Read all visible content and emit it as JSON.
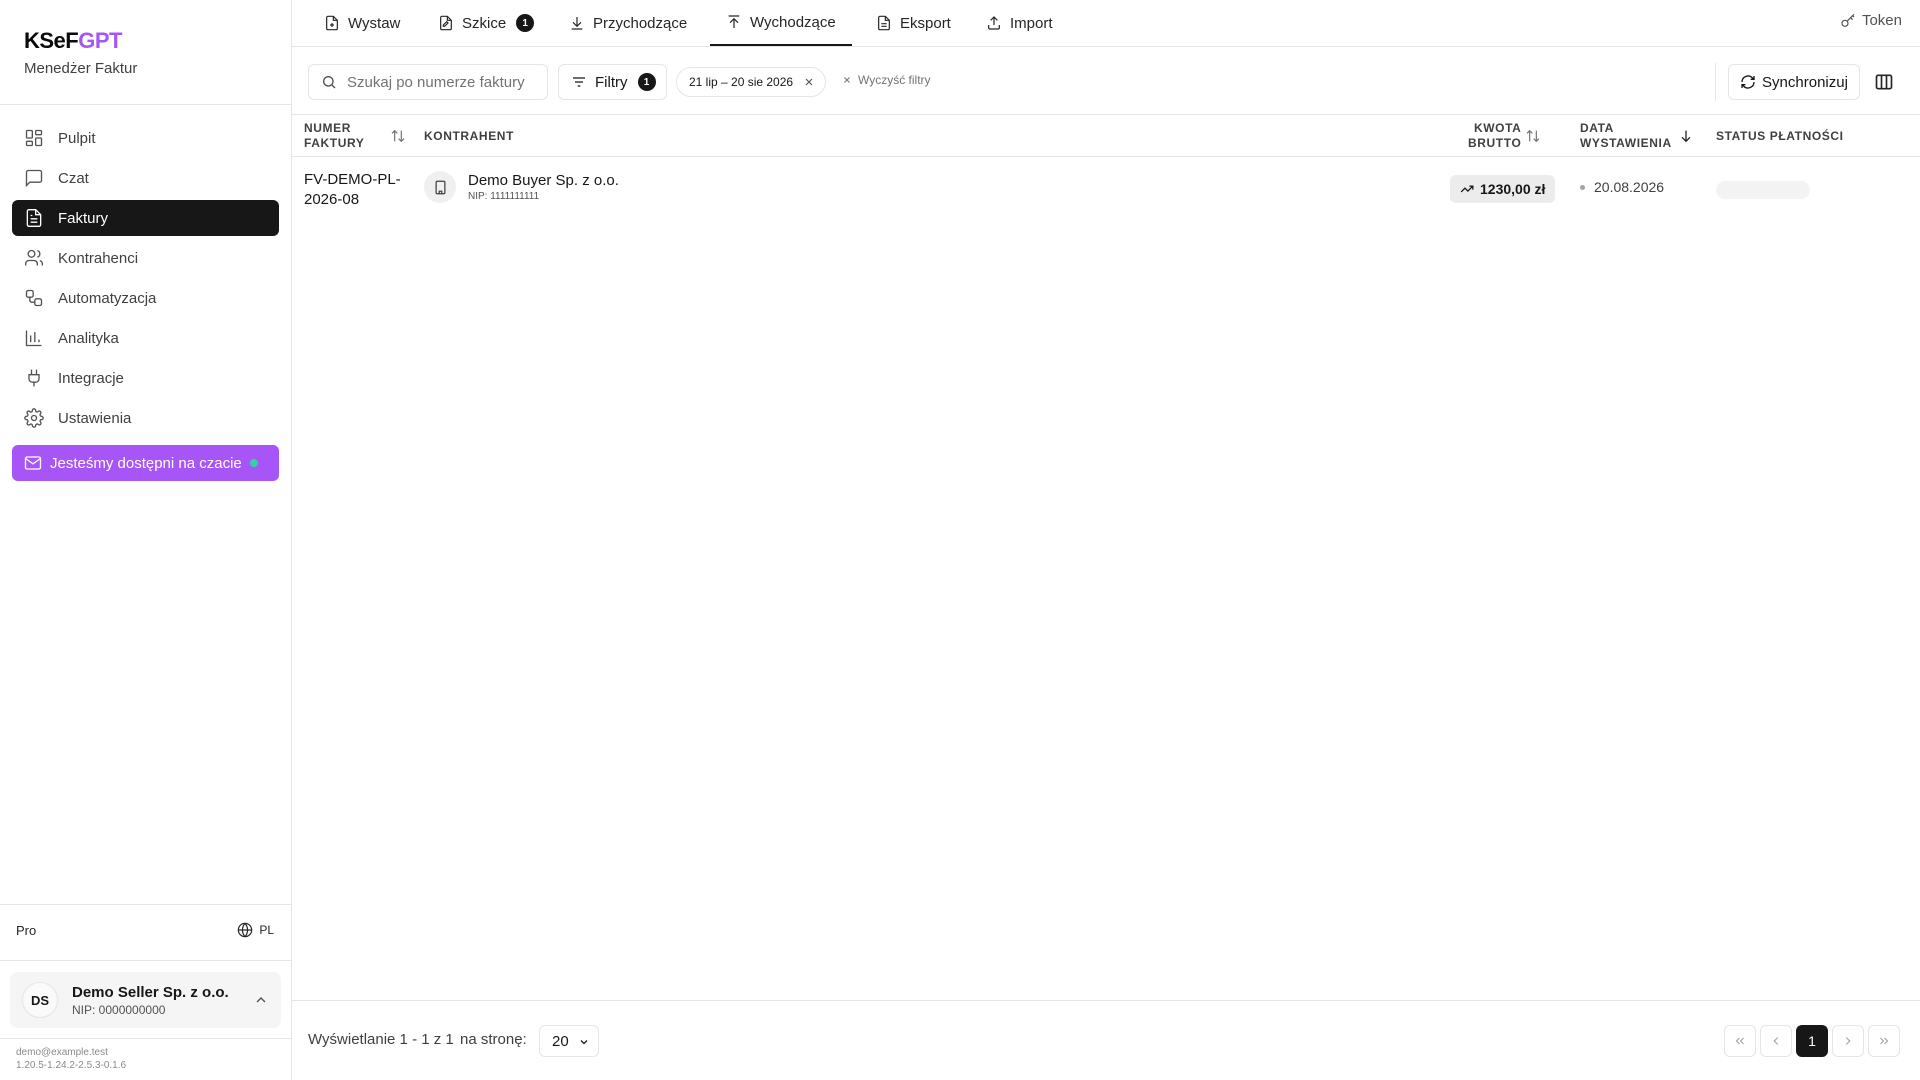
{
  "brand": {
    "name_part1": "KSeF",
    "name_part2": "GPT",
    "subtitle": "Menedżer Faktur",
    "accent": "#a855f7"
  },
  "sidebar": {
    "items": [
      {
        "label": "Pulpit",
        "icon": "dashboard-icon"
      },
      {
        "label": "Czat",
        "icon": "chat-icon"
      },
      {
        "label": "Faktury",
        "icon": "invoice-icon",
        "active": true
      },
      {
        "label": "Kontrahenci",
        "icon": "users-icon"
      },
      {
        "label": "Automatyzacja",
        "icon": "workflow-icon"
      },
      {
        "label": "Analityka",
        "icon": "bar-chart-icon"
      },
      {
        "label": "Integracje",
        "icon": "plug-icon"
      },
      {
        "label": "Ustawienia",
        "icon": "gear-icon"
      }
    ],
    "chat_cta": "Jesteśmy dostępni na czacie",
    "plan": "Pro",
    "language": "PL",
    "account": {
      "initials": "DS",
      "name": "Demo Seller Sp. z o.o.",
      "nip": "NIP: 0000000000"
    },
    "email": "demo@example.test",
    "version": "1.20.5-1.24.2-2.5.3-0.1.6"
  },
  "tabs": [
    {
      "label": "Wystaw",
      "icon": "file-plus-icon"
    },
    {
      "label": "Szkice",
      "icon": "draft-icon",
      "badge": "1"
    },
    {
      "label": "Przychodzące",
      "icon": "download-icon"
    },
    {
      "label": "Wychodzące",
      "icon": "upload-icon",
      "active": true
    },
    {
      "label": "Eksport",
      "icon": "file-text-icon"
    },
    {
      "label": "Import",
      "icon": "import-icon"
    }
  ],
  "token_label": "Token",
  "toolbar": {
    "search_placeholder": "Szukaj po numerze faktury",
    "filters_label": "Filtry",
    "filters_count": "1",
    "date_chip": "21 lip – 20 sie 2026",
    "clear_filters": "Wyczyść filtry",
    "sync_label": "Synchronizuj"
  },
  "table": {
    "headers": {
      "number_l1": "NUMER",
      "number_l2": "FAKTURY",
      "contractor": "KONTRAHENT",
      "amount_l1": "KWOTA",
      "amount_l2": "BRUTTO",
      "date_l1": "DATA",
      "date_l2": "WYSTAWIENIA",
      "status": "STATUS PŁATNOŚCI"
    },
    "rows": [
      {
        "number_l1": "FV-DEMO-PL-",
        "number_l2": "2026-08",
        "contractor_name": "Demo Buyer Sp. z o.o.",
        "contractor_nip": "NIP: 1111111111",
        "amount": "1230,00 zł",
        "date": "20.08.2026"
      }
    ]
  },
  "pagination": {
    "info": "Wyświetlanie 1 - 1 z 1",
    "per_page_label": "na stronę:",
    "per_page_value": "20",
    "current_page": "1"
  }
}
